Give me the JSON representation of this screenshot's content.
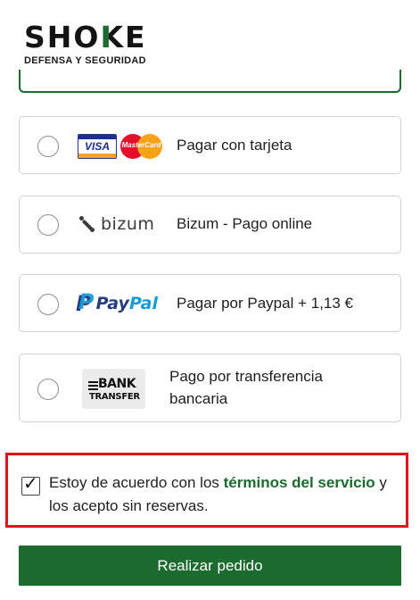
{
  "brand": {
    "letters": [
      "S",
      "H",
      "O",
      "K",
      "E"
    ],
    "tagline": "DEFENSA Y SEGURIDAD",
    "accent_color": "#1b6a2e"
  },
  "payment_options": [
    {
      "id": "card",
      "label": "Pagar con tarjeta",
      "logo": {
        "visa": "VISA",
        "mastercard": "MasterCard"
      },
      "selected": false
    },
    {
      "id": "bizum",
      "label": "Bizum - Pago online",
      "logo": {
        "text": "bizum"
      },
      "selected": false
    },
    {
      "id": "paypal",
      "label": "Pagar por Paypal + 1,13 €",
      "logo": {
        "pay": "Pay",
        "pal": "Pal"
      },
      "selected": false
    },
    {
      "id": "transfer",
      "label": "Pago por transferencia bancaria",
      "label_lines": [
        "Pago por transferencia",
        "bancaria"
      ],
      "logo": {
        "line1": "BANK",
        "line2": "TRANSFER"
      },
      "selected": false
    }
  ],
  "terms": {
    "checked": true,
    "text_before": "Estoy de acuerdo con los ",
    "link_text": "términos del servicio",
    "text_after": " y los acepto sin reservas.",
    "highlight_color": "#e0121c"
  },
  "submit_button": {
    "label": "Realizar pedido",
    "color": "#1b6a2e"
  }
}
